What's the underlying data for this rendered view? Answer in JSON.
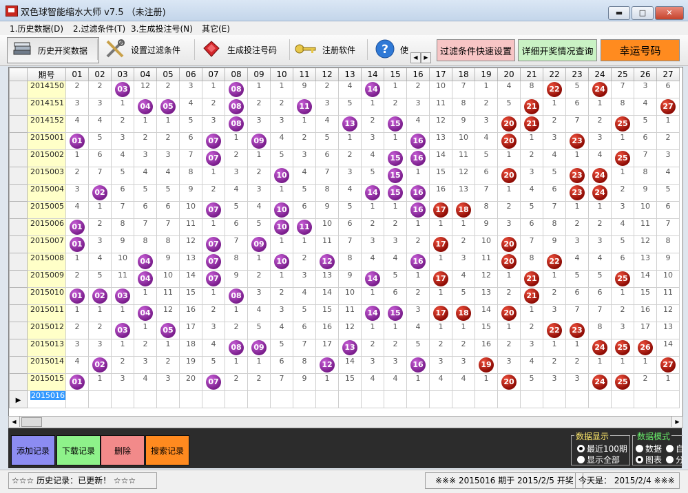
{
  "window": {
    "title": "双色球智能缩水大师 v7.5 （未注册)",
    "min": "▬",
    "max": "□",
    "close": "✕"
  },
  "menu": [
    "1.历史数据(D)",
    "2.过滤条件(T)",
    "3.生成投注号(N)",
    "其它(E)"
  ],
  "toolbar": {
    "history": "历史开奖数据",
    "filter": "设置过滤条件",
    "generate": "生成投注号码",
    "register": "注册软件",
    "help": "使",
    "quick_filter": "过滤条件快速设置",
    "detail_query": "详细开奖情况查询",
    "lucky": "幸运号码",
    "colors": {
      "quick_filter": "#f7c5c5",
      "detail_query": "#c9f2c4",
      "lucky": "#ff8b1f"
    }
  },
  "grid": {
    "period_header": "期号",
    "columns": [
      "01",
      "02",
      "03",
      "04",
      "05",
      "06",
      "07",
      "08",
      "09",
      "10",
      "11",
      "12",
      "13",
      "14",
      "15",
      "16",
      "17",
      "18",
      "19",
      "20",
      "21",
      "22",
      "23",
      "24",
      "25",
      "26",
      "27"
    ],
    "rows": [
      {
        "period": "2014150",
        "cells": [
          "2",
          "2",
          "03",
          "12",
          "2",
          "3",
          "1",
          "08",
          "1",
          "1",
          "9",
          "2",
          "4",
          "14",
          "1",
          "2",
          "10",
          "7",
          "1",
          "4",
          "8",
          "22",
          "5",
          "24",
          "7",
          "3",
          "6"
        ]
      },
      {
        "period": "2014151",
        "cells": [
          "3",
          "3",
          "1",
          "04",
          "05",
          "4",
          "2",
          "08",
          "2",
          "2",
          "11",
          "3",
          "5",
          "1",
          "2",
          "3",
          "11",
          "8",
          "2",
          "5",
          "21",
          "1",
          "6",
          "1",
          "8",
          "4",
          "27"
        ]
      },
      {
        "period": "2014152",
        "cells": [
          "4",
          "4",
          "2",
          "1",
          "1",
          "5",
          "3",
          "08",
          "3",
          "3",
          "1",
          "4",
          "13",
          "2",
          "15",
          "4",
          "12",
          "9",
          "3",
          "20",
          "21",
          "2",
          "7",
          "2",
          "25",
          "5",
          "1"
        ]
      },
      {
        "period": "2015001",
        "cells": [
          "01",
          "5",
          "3",
          "2",
          "2",
          "6",
          "07",
          "1",
          "09",
          "4",
          "2",
          "5",
          "1",
          "3",
          "1",
          "16",
          "13",
          "10",
          "4",
          "20",
          "1",
          "3",
          "23",
          "3",
          "1",
          "6",
          "2"
        ]
      },
      {
        "period": "2015002",
        "cells": [
          "1",
          "6",
          "4",
          "3",
          "3",
          "7",
          "07",
          "2",
          "1",
          "5",
          "3",
          "6",
          "2",
          "4",
          "15",
          "16",
          "14",
          "11",
          "5",
          "1",
          "2",
          "4",
          "1",
          "4",
          "25",
          "7",
          "3"
        ]
      },
      {
        "period": "2015003",
        "cells": [
          "2",
          "7",
          "5",
          "4",
          "4",
          "8",
          "1",
          "3",
          "2",
          "10",
          "4",
          "7",
          "3",
          "5",
          "15",
          "1",
          "15",
          "12",
          "6",
          "20",
          "3",
          "5",
          "23",
          "24",
          "1",
          "8",
          "4"
        ]
      },
      {
        "period": "2015004",
        "cells": [
          "3",
          "02",
          "6",
          "5",
          "5",
          "9",
          "2",
          "4",
          "3",
          "1",
          "5",
          "8",
          "4",
          "14",
          "15",
          "16",
          "16",
          "13",
          "7",
          "1",
          "4",
          "6",
          "23",
          "24",
          "2",
          "9",
          "5"
        ]
      },
      {
        "period": "2015005",
        "cells": [
          "4",
          "1",
          "7",
          "6",
          "6",
          "10",
          "07",
          "5",
          "4",
          "10",
          "6",
          "9",
          "5",
          "1",
          "1",
          "16",
          "17",
          "18",
          "8",
          "2",
          "5",
          "7",
          "1",
          "1",
          "3",
          "10",
          "6"
        ]
      },
      {
        "period": "2015006",
        "cells": [
          "01",
          "2",
          "8",
          "7",
          "7",
          "11",
          "1",
          "6",
          "5",
          "10",
          "11",
          "10",
          "6",
          "2",
          "2",
          "1",
          "1",
          "1",
          "9",
          "3",
          "6",
          "8",
          "2",
          "2",
          "4",
          "11",
          "7"
        ]
      },
      {
        "period": "2015007",
        "cells": [
          "01",
          "3",
          "9",
          "8",
          "8",
          "12",
          "07",
          "7",
          "09",
          "1",
          "1",
          "11",
          "7",
          "3",
          "3",
          "2",
          "17",
          "2",
          "10",
          "20",
          "7",
          "9",
          "3",
          "3",
          "5",
          "12",
          "8"
        ]
      },
      {
        "period": "2015008",
        "cells": [
          "1",
          "4",
          "10",
          "04",
          "9",
          "13",
          "07",
          "8",
          "1",
          "10",
          "2",
          "12",
          "8",
          "4",
          "4",
          "16",
          "1",
          "3",
          "11",
          "20",
          "8",
          "22",
          "4",
          "4",
          "6",
          "13",
          "9"
        ]
      },
      {
        "period": "2015009",
        "cells": [
          "2",
          "5",
          "11",
          "04",
          "10",
          "14",
          "07",
          "9",
          "2",
          "1",
          "3",
          "13",
          "9",
          "14",
          "5",
          "1",
          "17",
          "4",
          "12",
          "1",
          "21",
          "1",
          "5",
          "5",
          "25",
          "14",
          "10"
        ]
      },
      {
        "period": "2015010",
        "cells": [
          "01",
          "02",
          "03",
          "1",
          "11",
          "15",
          "1",
          "08",
          "3",
          "2",
          "4",
          "14",
          "10",
          "1",
          "6",
          "2",
          "1",
          "5",
          "13",
          "2",
          "21",
          "2",
          "6",
          "6",
          "1",
          "15",
          "11"
        ]
      },
      {
        "period": "2015011",
        "cells": [
          "1",
          "1",
          "1",
          "04",
          "12",
          "16",
          "2",
          "1",
          "4",
          "3",
          "5",
          "15",
          "11",
          "14",
          "15",
          "3",
          "17",
          "18",
          "14",
          "20",
          "1",
          "3",
          "7",
          "7",
          "2",
          "16",
          "12"
        ]
      },
      {
        "period": "2015012",
        "cells": [
          "2",
          "2",
          "03",
          "1",
          "05",
          "17",
          "3",
          "2",
          "5",
          "4",
          "6",
          "16",
          "12",
          "1",
          "1",
          "4",
          "1",
          "1",
          "15",
          "1",
          "2",
          "22",
          "23",
          "8",
          "3",
          "17",
          "13"
        ]
      },
      {
        "period": "2015013",
        "cells": [
          "3",
          "3",
          "1",
          "2",
          "1",
          "18",
          "4",
          "08",
          "09",
          "5",
          "7",
          "17",
          "13",
          "2",
          "2",
          "5",
          "2",
          "2",
          "16",
          "2",
          "3",
          "1",
          "1",
          "24",
          "25",
          "26",
          "14"
        ]
      },
      {
        "period": "2015014",
        "cells": [
          "4",
          "02",
          "2",
          "3",
          "2",
          "19",
          "5",
          "1",
          "1",
          "6",
          "8",
          "12",
          "14",
          "3",
          "3",
          "16",
          "3",
          "3",
          "19",
          "3",
          "4",
          "2",
          "2",
          "1",
          "1",
          "1",
          "27"
        ]
      },
      {
        "period": "2015015",
        "cells": [
          "01",
          "1",
          "3",
          "4",
          "3",
          "20",
          "07",
          "2",
          "2",
          "7",
          "9",
          "1",
          "15",
          "4",
          "4",
          "1",
          "4",
          "4",
          "1",
          "20",
          "5",
          "3",
          "3",
          "24",
          "25",
          "2",
          "1"
        ]
      }
    ],
    "current_period": "2015016"
  },
  "actions": {
    "add": "添加记录",
    "download": "下载记录",
    "delete": "删除",
    "search": "搜索记录",
    "colors": {
      "add": "#8c8cf2",
      "download": "#8ef28a",
      "delete": "#f28a8a",
      "search": "#ff8a1f"
    }
  },
  "display_group": {
    "title": "数据显示",
    "options": [
      "最近100期",
      "显示全部"
    ],
    "selected": 0
  },
  "mode_group": {
    "title": "数据模式",
    "options": [
      "数据",
      "自",
      "图表",
      "分"
    ],
    "selected": 2
  },
  "status": {
    "history": "☆☆☆ 历史记录：已更新！ ☆☆☆",
    "next_draw": "※※※ 2015016 期于 2015/2/5 开奖",
    "today": "今天是： 2015/2/4 ※※※"
  }
}
